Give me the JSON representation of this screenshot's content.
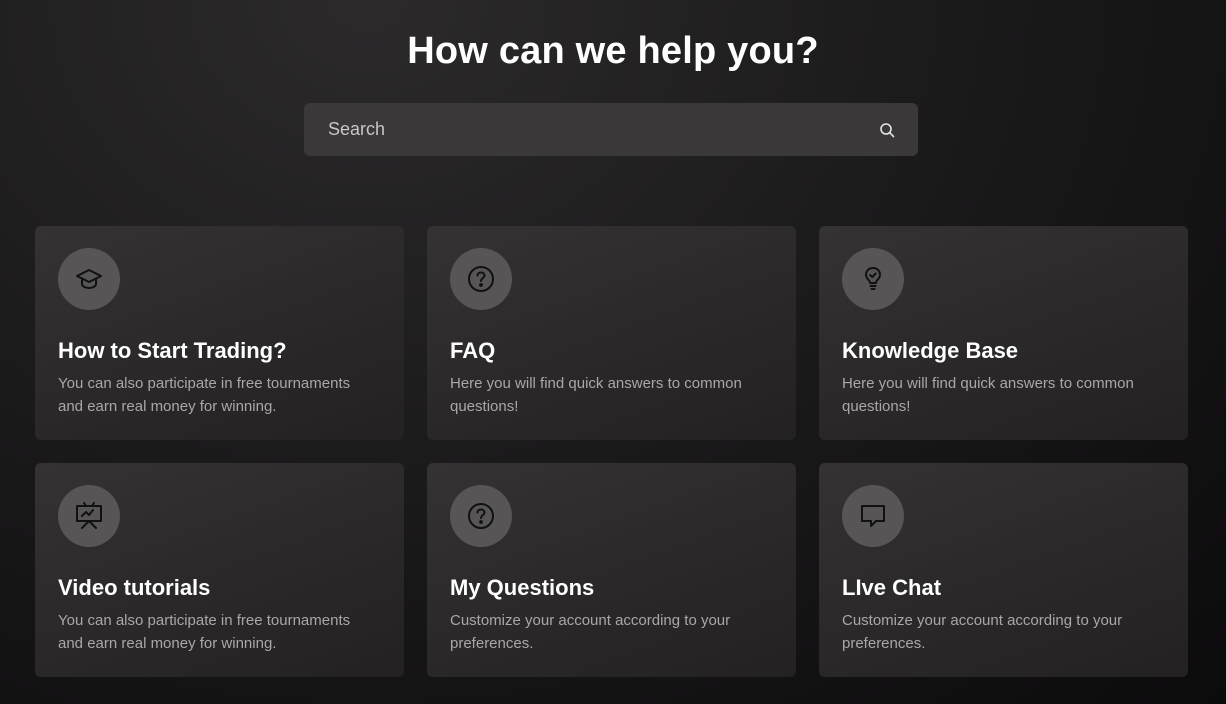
{
  "header": {
    "title": "How can we help you?"
  },
  "search": {
    "placeholder": "Search",
    "value": "",
    "icon": "search-icon"
  },
  "cards": [
    {
      "icon": "graduation-cap-icon",
      "title": "How to Start Trading?",
      "description": "You can also participate in free tournaments and earn real money for winning."
    },
    {
      "icon": "question-circle-icon",
      "title": "FAQ",
      "description": "Here you will find quick answers to common questions!"
    },
    {
      "icon": "lightbulb-icon",
      "title": "Knowledge Base",
      "description": "Here you will find quick answers to common questions!"
    },
    {
      "icon": "presentation-board-icon",
      "title": "Video tutorials",
      "description": "You can also participate in free tournaments and earn real money for winning."
    },
    {
      "icon": "question-circle-icon",
      "title": "My Questions",
      "description": "Customize your account according to your preferences."
    },
    {
      "icon": "chat-bubble-icon",
      "title": "LIve Chat",
      "description": "Customize your account according to your preferences."
    }
  ],
  "colors": {
    "background": "#1c1b1c",
    "card": "#2e2c2d",
    "icon_circle": "#575556",
    "title_text": "#ffffff",
    "description_text": "#a9a7a8",
    "search_field": "#3a3839"
  }
}
